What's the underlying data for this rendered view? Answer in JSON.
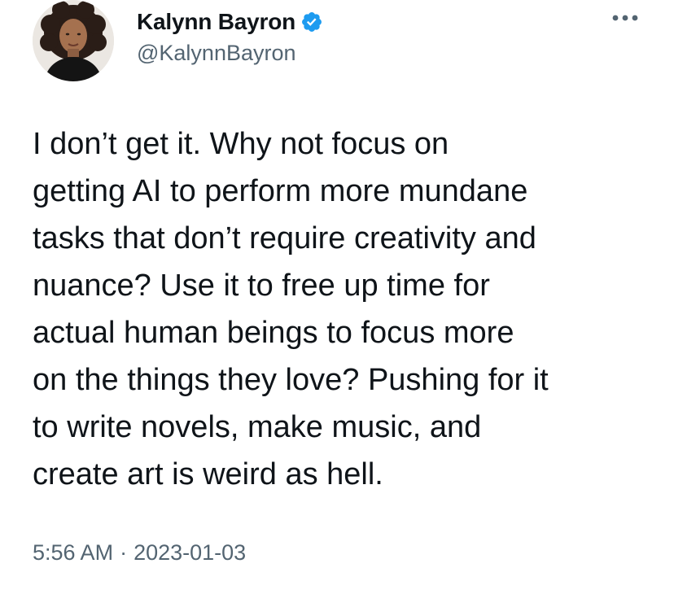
{
  "author": {
    "name": "Kalynn Bayron",
    "handle": "@KalynnBayron",
    "verified": true,
    "avatar_icon": "profile-photo"
  },
  "menu": {
    "icon": "more-dots-icon"
  },
  "tweet": {
    "lines": [
      "I don’t get it. Why not focus on",
      "getting AI to perform more mundane",
      "tasks that don’t require creativity and",
      "nuance? Use it to free up time for",
      "actual human beings to focus more",
      "on the things they love? Pushing for it",
      "to write novels, make music, and",
      "create art is weird as hell."
    ]
  },
  "meta": {
    "time": "5:56 AM",
    "separator": "·",
    "date": "2023-01-03"
  },
  "colors": {
    "text": "#0f1419",
    "secondary": "#536471",
    "verified_badge": "#1d9bf0"
  }
}
